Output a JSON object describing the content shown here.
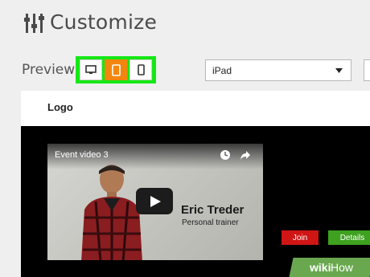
{
  "header": {
    "title": "Customize",
    "icon": "sliders-icon"
  },
  "preview": {
    "label": "Preview",
    "devices": [
      {
        "icon": "monitor-icon",
        "active": false
      },
      {
        "icon": "tablet-icon",
        "active": true
      },
      {
        "icon": "phone-icon",
        "active": false
      }
    ],
    "device_select": {
      "value": "iPad"
    }
  },
  "panel": {
    "logo": "Logo",
    "video": {
      "title": "Event video 3",
      "name": "Eric Treder",
      "role": "Personal trainer"
    },
    "buttons": {
      "join": "Join",
      "details": "Details"
    }
  },
  "watermark": {
    "prefix": "wiki",
    "suffix": "How"
  },
  "colors": {
    "highlight_green": "#16e816",
    "active_orange": "#f4860d",
    "join_red": "#d01515",
    "details_green": "#3ea11f",
    "watermark_green": "#6aa84f"
  }
}
